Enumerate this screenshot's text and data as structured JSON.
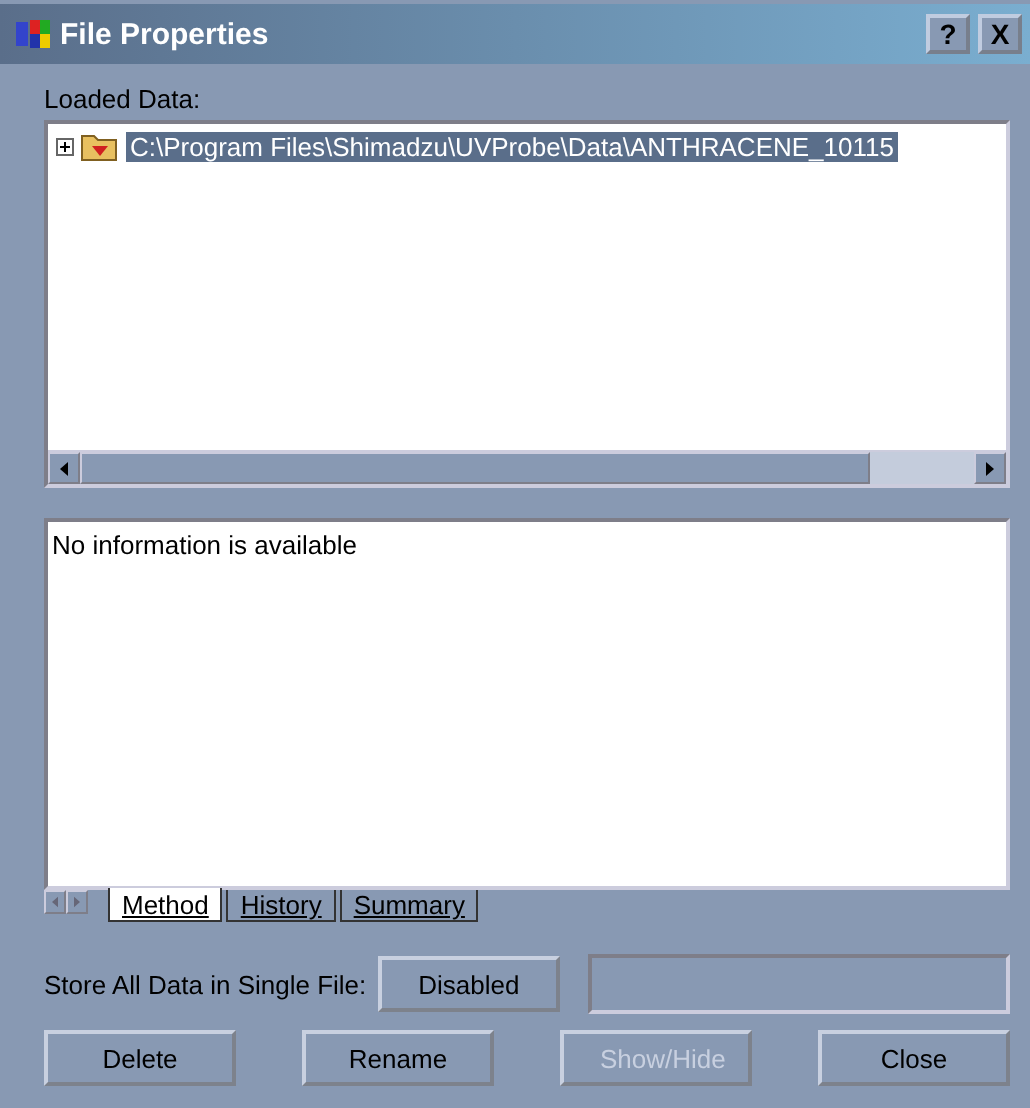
{
  "window": {
    "title": "File Properties",
    "help_button": "?",
    "close_button": "X"
  },
  "loaded_data": {
    "label": "Loaded Data:",
    "items": [
      {
        "text": "C:\\Program Files\\Shimadzu\\UVProbe\\Data\\ANTHRACENE_10115",
        "expanded": false,
        "selected": true
      }
    ]
  },
  "info": {
    "text": "No information is available"
  },
  "tabs": [
    {
      "label": "Method",
      "selected": true
    },
    {
      "label": "History",
      "selected": false
    },
    {
      "label": "Summary",
      "selected": false
    }
  ],
  "store": {
    "label": "Store All Data in Single File:",
    "button": "Disabled"
  },
  "buttons": [
    {
      "label": "Delete",
      "disabled": false
    },
    {
      "label": "Rename",
      "disabled": false
    },
    {
      "label": "Show/Hide",
      "disabled": true
    },
    {
      "label": "Close",
      "disabled": false
    }
  ]
}
